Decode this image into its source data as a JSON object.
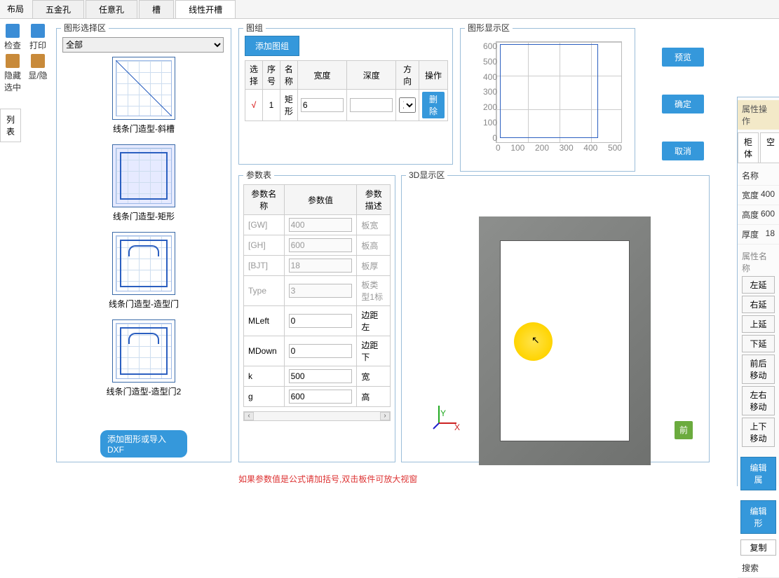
{
  "tabs": {
    "layout": "布局",
    "hardware": "五金孔",
    "anyhole": "任意孔",
    "slot": "槽",
    "linear": "线性开槽"
  },
  "left_tools": {
    "check": "检查",
    "print": "打印",
    "hide": "隐藏选中",
    "show": "显/隐"
  },
  "side_tab": "列表",
  "shape": {
    "title": "图形选择区",
    "filter": "全部",
    "items": [
      "线条门造型-斜槽",
      "线条门造型-矩形",
      "线条门造型-造型门",
      "线条门造型-造型门2"
    ],
    "import_btn": "添加图形或导入DXF"
  },
  "group": {
    "title": "图组",
    "add_btn": "添加图组",
    "headers": {
      "sel": "选择",
      "idx": "序号",
      "name": "名称",
      "w": "宽度",
      "d": "深度",
      "dir": "方向",
      "op": "操作"
    },
    "row": {
      "check": "√",
      "idx": "1",
      "name": "矩形",
      "w": "6",
      "d": "",
      "dir": "正面",
      "del": "删除"
    }
  },
  "disp": {
    "title": "图形显示区"
  },
  "chart_data": {
    "type": "line",
    "title": "",
    "xlabel": "",
    "ylabel": "",
    "x_ticks": [
      "0",
      "100",
      "200",
      "300",
      "400",
      "500"
    ],
    "y_ticks": [
      "600",
      "500",
      "400",
      "300",
      "200",
      "100",
      "0"
    ],
    "xlim": [
      0,
      500
    ],
    "ylim": [
      0,
      600
    ],
    "series": [
      {
        "name": "rect",
        "type": "rect",
        "x": [
          50,
          400
        ],
        "y": [
          50,
          550
        ]
      }
    ]
  },
  "side_buttons": {
    "preview": "预览",
    "ok": "确定",
    "cancel": "取消"
  },
  "params": {
    "title": "参数表",
    "headers": {
      "name": "参数名称",
      "val": "参数值",
      "desc": "参数描述"
    },
    "rows": [
      {
        "name": "[GW]",
        "val": "400",
        "desc": "板宽",
        "ro": true
      },
      {
        "name": "[GH]",
        "val": "600",
        "desc": "板高",
        "ro": true
      },
      {
        "name": "[BJT]",
        "val": "18",
        "desc": "板厚",
        "ro": true
      },
      {
        "name": "Type",
        "val": "3",
        "desc": "板类型1标",
        "ro": true
      },
      {
        "name": "MLeft",
        "val": "0",
        "desc": "边距左",
        "ro": false
      },
      {
        "name": "MDown",
        "val": "0",
        "desc": "边距下",
        "ro": false
      },
      {
        "name": "k",
        "val": "500",
        "desc": "宽",
        "ro": false
      },
      {
        "name": "g",
        "val": "600",
        "desc": "高",
        "ro": false
      }
    ]
  },
  "view3d": {
    "title": "3D显示区",
    "axis_x": "X",
    "axis_y": "Y",
    "front": "前"
  },
  "footer": "如果参数值是公式请加括号,双击板件可放大视窗",
  "props": {
    "title": "属性操作",
    "tabs": {
      "cabinet": "柜体",
      "sec": "空"
    },
    "rows": {
      "name_k": "名称",
      "w_k": "宽度",
      "w_v": "400",
      "h_k": "高度",
      "h_v": "600",
      "t_k": "厚度",
      "t_v": "18"
    },
    "attr_name": "属性名称",
    "btns": [
      "左延",
      "右延",
      "上延",
      "下延",
      "前后移动",
      "左右移动",
      "上下移动"
    ],
    "edit_attr": "编辑属",
    "edit_shape": "编辑形",
    "copy": "复制",
    "search": "搜索"
  }
}
